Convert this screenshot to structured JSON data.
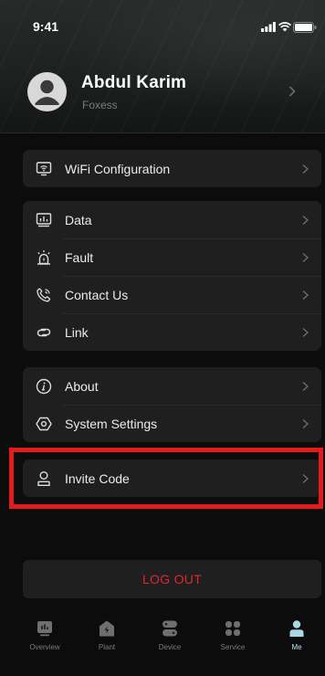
{
  "status_bar": {
    "time": "9:41"
  },
  "profile": {
    "name": "Abdul Karim",
    "company": "Foxess"
  },
  "groups": [
    {
      "items": [
        {
          "label": "WiFi Configuration",
          "icon": "wifi-config-icon"
        }
      ]
    },
    {
      "items": [
        {
          "label": "Data",
          "icon": "data-monitor-icon"
        },
        {
          "label": "Fault",
          "icon": "alarm-icon"
        },
        {
          "label": "Contact Us",
          "icon": "phone-icon"
        },
        {
          "label": "Link",
          "icon": "link-icon"
        }
      ]
    },
    {
      "items": [
        {
          "label": "About",
          "icon": "info-icon"
        },
        {
          "label": "System Settings",
          "icon": "settings-hex-icon"
        }
      ]
    },
    {
      "items": [
        {
          "label": "Invite Code",
          "icon": "user-icon"
        }
      ]
    }
  ],
  "logout_label": "LOG OUT",
  "bottom_nav": [
    {
      "label": "Overview",
      "icon": "overview-icon"
    },
    {
      "label": "Plant",
      "icon": "plant-icon"
    },
    {
      "label": "Device",
      "icon": "device-icon"
    },
    {
      "label": "Service",
      "icon": "service-icon"
    },
    {
      "label": "Me",
      "icon": "me-icon",
      "active": true
    }
  ],
  "colors": {
    "accent_red": "#e3262b",
    "highlight": "#e31b1b",
    "active_tab": "#bfe3ec"
  }
}
